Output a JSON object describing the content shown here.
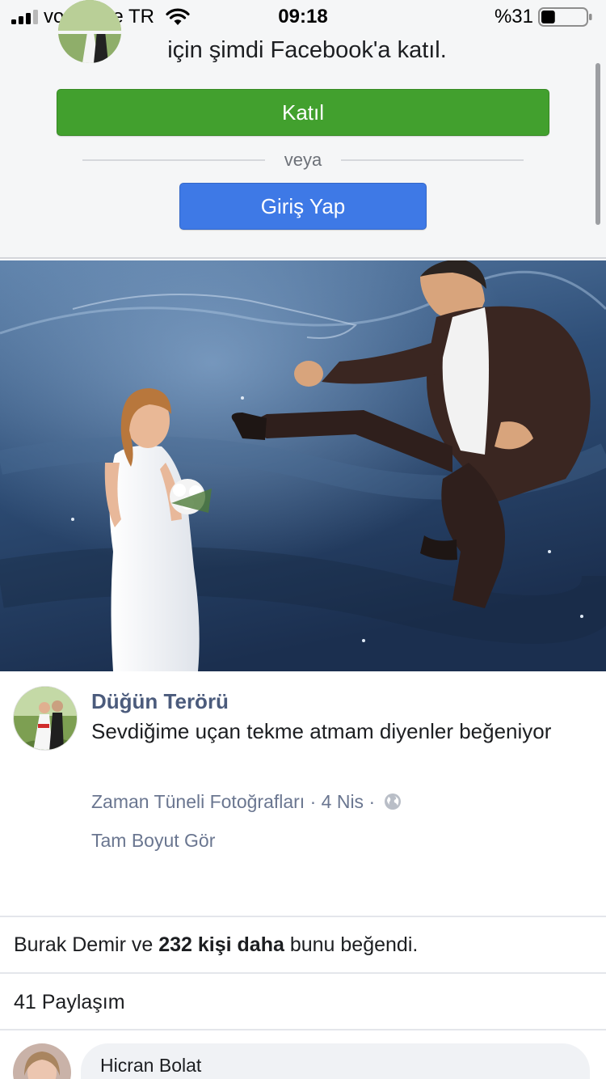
{
  "status_bar": {
    "carrier": "vodafone TR",
    "time": "09:18",
    "battery": "%31",
    "battery_level": 0.31,
    "signal_bars": 3,
    "signal_bars_total": 4
  },
  "join_panel": {
    "text": "için şimdi Facebook'a katıl.",
    "join_label": "Katıl",
    "or_label": "veya",
    "login_label": "Giriş Yap"
  },
  "post": {
    "author": "Düğün Terörü",
    "text": "Sevdiğime uçan tekme atmam diyenler beğeniyor",
    "album": "Zaman Tüneli Fotoğrafları",
    "date": "4 Nis",
    "separator": "·",
    "view_full_size": "Tam Boyut Gör"
  },
  "likes": {
    "name": "Burak Demir",
    "and": "ve",
    "count_text": "232 kişi daha",
    "suffix": "bunu beğendi."
  },
  "shares": {
    "text": "41 Paylaşım"
  },
  "comment": {
    "author": "Hicran Bolat"
  },
  "colors": {
    "join_button": "#42a02e",
    "login_button": "#3e79e6",
    "author_link": "#4b5b7c",
    "meta_text": "#6a7690",
    "panel_bg": "#f5f6f7"
  },
  "icons": {
    "signal": "cellular-signal-icon",
    "wifi": "wifi-icon",
    "battery": "battery-icon",
    "privacy": "globe-icon"
  }
}
